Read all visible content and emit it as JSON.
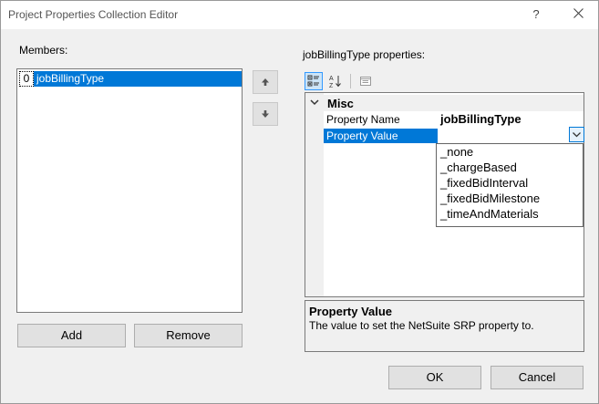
{
  "window": {
    "title": "Project Properties Collection Editor",
    "help": "?",
    "close_icon": "close-icon"
  },
  "members": {
    "label": "Members:",
    "items": [
      {
        "index": "0",
        "name": "jobBillingType",
        "selected": true
      }
    ],
    "add_label": "Add",
    "remove_label": "Remove"
  },
  "properties": {
    "label": "jobBillingType properties:",
    "category": "Misc",
    "rows": [
      {
        "name": "Property Name",
        "value": "jobBillingType"
      },
      {
        "name": "Property Value",
        "value": ""
      }
    ],
    "dropdown_options": [
      "_none",
      "_chargeBased",
      "_fixedBidInterval",
      "_fixedBidMilestone",
      "_timeAndMaterials"
    ],
    "description_title": "Property Value",
    "description_text": "The value to set the NetSuite SRP property to."
  },
  "footer": {
    "ok_label": "OK",
    "cancel_label": "Cancel"
  },
  "colors": {
    "selection": "#0078d7",
    "dialog_bg": "#f0f0f0"
  }
}
